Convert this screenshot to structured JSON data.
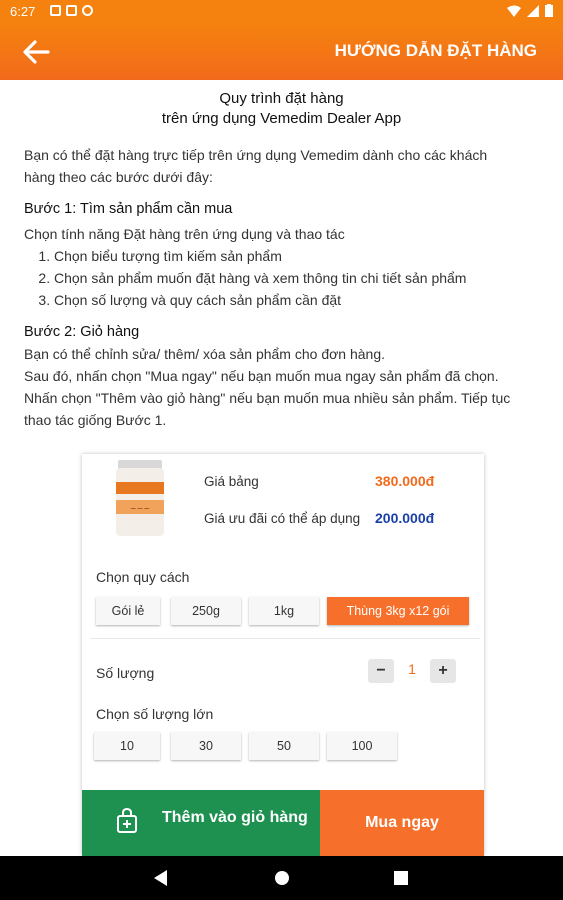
{
  "status": {
    "time": "6:27"
  },
  "header": {
    "title": "HƯỚNG DẪN ĐẶT HÀNG",
    "back_icon": "arrow-left-icon"
  },
  "doc": {
    "title_line1": "Quy trình đặt hàng",
    "title_line2": "trên ứng dụng Vemedim Dealer App",
    "intro_line1": "Bạn có thể đặt hàng trực tiếp trên ứng dụng Vemedim dành cho các khách",
    "intro_line2": "hàng theo các bước dưới đây:",
    "step1": {
      "heading": "Bước 1: Tìm sản phẩm cần mua",
      "desc": "Chọn tính năng Đặt hàng trên ứng dụng và thao tác",
      "items": [
        "Chọn biểu tượng tìm kiếm sản phẩm",
        "Chọn sản phẩm muốn đặt hàng và xem thông tin chi tiết sản phẩm",
        "Chọn số lượng và quy cách sản phẩm cần đặt"
      ]
    },
    "step2": {
      "heading": "Bước 2: Giỏ hàng",
      "lines": [
        "Bạn có thể chỉnh sửa/ thêm/ xóa sản phẩm cho đơn hàng.",
        "Sau đó, nhấn chọn \"Mua ngay\" nếu bạn muốn mua ngay sản phẩm đã chọn.",
        "Nhấn chọn \"Thêm vào giỏ hàng\" nếu bạn muốn mua nhiều sản phẩm. Tiếp tục",
        "thao tác giống Bước 1."
      ]
    }
  },
  "product": {
    "list_price_label": "Giá bảng",
    "list_price": "380.000đ",
    "promo_price_label": "Giá ưu đãi có thể áp dụng",
    "promo_price": "200.000đ",
    "spec_label": "Chọn quy cách",
    "specs": [
      "Gói lẻ",
      "250g",
      "1kg",
      "Thùng 3kg x12 gói"
    ],
    "selected_spec": "Thùng 3kg x12 gói",
    "qty_label": "Số lượng",
    "qty": "1",
    "bulk_label": "Chọn số lượng lớn",
    "bulk": [
      "10",
      "30",
      "50",
      "100"
    ]
  },
  "actions": {
    "add_to_cart": "Thêm vào giỏ hàng",
    "buy_now": "Mua ngay"
  },
  "colors": {
    "accent": "#f5820f",
    "green": "#1e9150",
    "orange_btn": "#f7702b",
    "blue_price": "#1a3fa8"
  }
}
